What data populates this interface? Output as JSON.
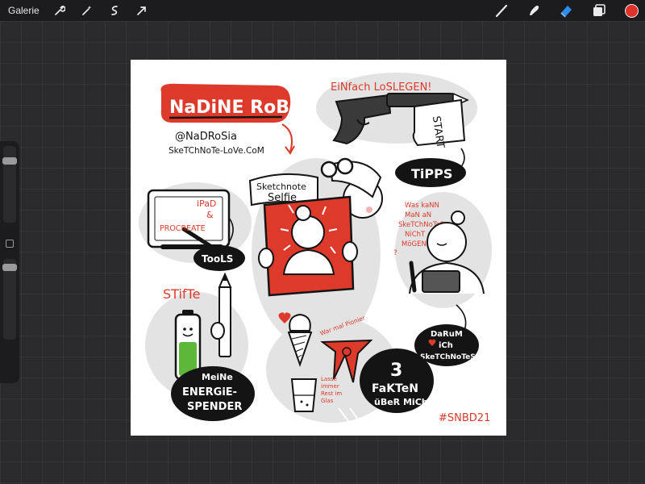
{
  "toolbar": {
    "gallery_label": "Galerie",
    "active_color": "#e0312a",
    "icons": [
      "wrench-icon",
      "magic-wand-icon",
      "selection-icon",
      "transform-arrow-icon",
      "brush-icon",
      "smudge-icon",
      "eraser-icon",
      "layers-icon"
    ]
  },
  "canvas": {
    "name_title": "NaDiNE RoBa",
    "handle": "@NaDRoSia",
    "website": "SkeTChNoTe-LoVe.CoM",
    "start_heading": "EiNfach LoSLEGEN!",
    "start_sign": "START",
    "tipps_label": "TiPPS",
    "selfie_label_1": "Sketchnote",
    "selfie_label_2": "Selfie",
    "ipad_label": "iPaD",
    "ampersand": "&",
    "procreate_label": "PROCREATE",
    "tools_label": "TooLS",
    "question_lines": [
      "Was kaNN",
      "MaN aN",
      "SkeTChNoTeS",
      "NiChT",
      "MöGEN",
      "?"
    ],
    "stifte_label": "STifTe",
    "energy_lines": [
      "MeiNe",
      "ENERGiE-",
      "SPENDER"
    ],
    "pionier_label": "War mal Pionier",
    "glass_lines": [
      "Lasse",
      "immer",
      "Rest im",
      "Glas"
    ],
    "facts_lines": [
      "3",
      "FaKTeN",
      "üBeR MiCh"
    ],
    "darum_lines": [
      "DaRuM",
      "iCh",
      "SkeTChNoTeS"
    ],
    "hashtag": "#SNBD21"
  },
  "colors": {
    "accent_red": "#dd3a2c",
    "ink": "#141414",
    "shade": "#e3e3e3"
  }
}
